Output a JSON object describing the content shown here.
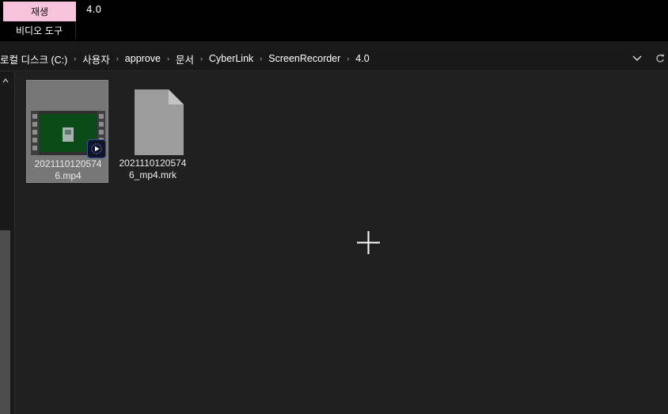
{
  "ribbon": {
    "context_tab": "재생",
    "context_sub": "비디오 도구",
    "window_title": "4.0"
  },
  "addressbar": {
    "crumbs": [
      "로컬 디스크 (C:)",
      "사용자",
      "approve",
      "문서",
      "CyberLink",
      "ScreenRecorder",
      "4.0"
    ],
    "dropdown_icon": "chevron-down-icon",
    "refresh_icon": "refresh-icon"
  },
  "files": [
    {
      "name_line1": "2021110120574",
      "name_line2": "6.mp4",
      "type": "video",
      "selected": true
    },
    {
      "name_line1": "2021110120574",
      "name_line2": "6_mp4.mrk",
      "type": "generic-file",
      "selected": false
    }
  ],
  "colors": {
    "context_tab_bg": "#f7c2dc",
    "content_bg": "#202020",
    "selection_bg": "#777777",
    "thumb_screen": "#0b4b1a"
  }
}
